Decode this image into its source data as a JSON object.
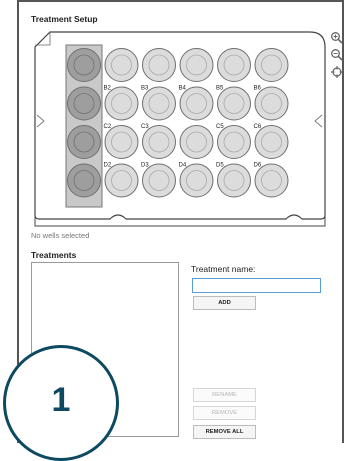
{
  "setup": {
    "title": "Treatment Setup"
  },
  "plate": {
    "rows": [
      "A",
      "B",
      "C",
      "D"
    ],
    "columns": 6,
    "highlighted_column": 1,
    "visible_well_labels": [
      "B2",
      "B3",
      "B4",
      "B5",
      "B6",
      "C2",
      "C3",
      "C5",
      "C6",
      "D2",
      "D3",
      "D4",
      "D5",
      "D6"
    ]
  },
  "toolbar": {
    "zoom_in": "zoom-in-icon",
    "zoom_out": "zoom-out-icon",
    "center": "crosshair-icon"
  },
  "status": {
    "text": "No wells selected"
  },
  "treatments": {
    "title": "Treatments",
    "name_label": "Treatment name:",
    "name_value": "",
    "add_label": "ADD",
    "rename_label": "RENAME",
    "remove_label": "REMOVE",
    "remove_all_label": "REMOVE ALL"
  },
  "badge": {
    "number": "1"
  },
  "colors": {
    "accent": "#5b9bd5",
    "badge": "#0d4a61"
  }
}
